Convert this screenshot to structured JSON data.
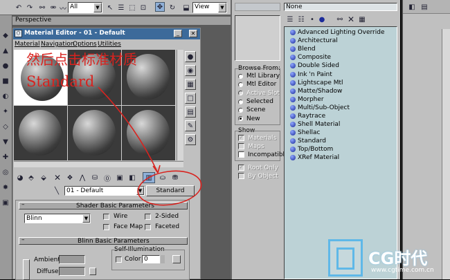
{
  "toolbar": {
    "filter_value": "All",
    "view_value": "View"
  },
  "viewport": {
    "label": "Perspective"
  },
  "material_editor": {
    "title": "Material Editor - 01 - Default",
    "menus": [
      "Material",
      "Navigation",
      "Options",
      "Utilities"
    ],
    "annotation_line1": "然后点击标准材质",
    "annotation_line2": "Standard",
    "material_name": "01 - Default",
    "type_button": "Standard",
    "shader_rollout": "Shader Basic Parameters",
    "shader_value": "Blinn",
    "checkbox_wire": "Wire",
    "checkbox_2sided": "2-Sided",
    "checkbox_facemap": "Face Map",
    "checkbox_faceted": "Faceted",
    "blinn_rollout": "Blinn Basic Parameters",
    "self_illum_label": "Self-Illumination",
    "color_label": "Color",
    "color_value": "0",
    "ambient_label": "Ambient:",
    "diffuse_label": "Diffuse:"
  },
  "browser": {
    "search_value": "None",
    "browse_from_title": "Browse From:",
    "browse_from": [
      "Mtl Library",
      "Mtl Editor",
      "Active Slot",
      "Selected",
      "Scene",
      "New"
    ],
    "show_title": "Show",
    "show_items": [
      "Materials",
      "Maps",
      "Incompatible"
    ],
    "root_only": "Root Only",
    "by_object": "By Object",
    "materials": [
      "Advanced Lighting Override",
      "Architectural",
      "Blend",
      "Composite",
      "Double Sided",
      "Ink 'n Paint",
      "Lightscape Mtl",
      "Matte/Shadow",
      "Morpher",
      "Multi/Sub-Object",
      "Raytrace",
      "Shell Material",
      "Shellac",
      "Standard",
      "Top/Bottom",
      "XRef Material"
    ]
  },
  "watermark": {
    "brand": "CG时代",
    "url": "www.cgtime.com.cn"
  },
  "colors": {
    "ui_gray": "#c0c0c0",
    "list_bg": "#bcd2d6",
    "title_bar": "#3c6a9a",
    "annotation": "#d8231f",
    "bullet": "#1b2b9a"
  }
}
